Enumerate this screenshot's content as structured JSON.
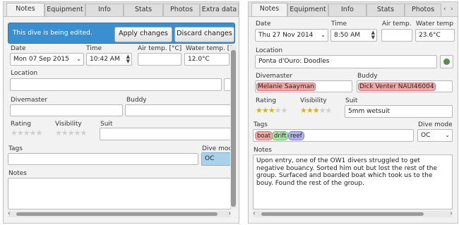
{
  "left": {
    "tabs": [
      "Notes",
      "Equipment",
      "Info",
      "Stats",
      "Photos",
      "Extra data"
    ],
    "banner": {
      "message": "This dive is being edited.",
      "apply": "Apply changes",
      "discard": "Discard changes"
    },
    "labels": {
      "date": "Date",
      "time": "Time",
      "air_temp": "Air temp. [°C]",
      "water_temp": "Water temp. [°C]",
      "location": "Location",
      "divemaster": "Divemaster",
      "buddy": "Buddy",
      "rating": "Rating",
      "visibility": "Visibility",
      "suit": "Suit",
      "tags": "Tags",
      "dive_mode": "Dive mode",
      "notes": "Notes"
    },
    "values": {
      "date": "Mon 07 Sep 2015",
      "time": "10:42 AM",
      "air_temp": "",
      "water_temp": "12.0°C",
      "dive_mode": "OC"
    },
    "rating": 0,
    "visibility": 0
  },
  "right": {
    "tabs": [
      "Notes",
      "Equipment",
      "Info",
      "Stats",
      "Photos"
    ],
    "labels": {
      "date": "Date",
      "time": "Time",
      "air_temp": "Air temp.",
      "water_temp": "Water temp",
      "location": "Location",
      "divemaster": "Divemaster",
      "buddy": "Buddy",
      "rating": "Rating",
      "visibility": "Visibility",
      "suit": "Suit",
      "tags": "Tags",
      "dive_mode": "Dive mode",
      "notes": "Notes"
    },
    "values": {
      "date": "Thu 27 Nov 2014",
      "time": "8:50 AM",
      "air_temp": "",
      "water_temp": "23.6°C",
      "location": "Ponta d'Ouro: Doodles",
      "divemaster": "Melanie Saayman",
      "buddy": "Dick Venter NAUI46004",
      "suit": "5mm wetsuit",
      "dive_mode": "OC",
      "notes": "Upon entry, one of the OW1 divers struggled to get negative bouancy. Sorted him out but lost the rest of the group. Surfaced and boarded boat which took us to the bouy. Found the rest of the group."
    },
    "tags": [
      {
        "label": "boat",
        "color": "#f3a7a7"
      },
      {
        "label": "drift",
        "color": "#a8e6a0"
      },
      {
        "label": "reef",
        "color": "#b3b3f0"
      }
    ],
    "rating": 3,
    "visibility": 3
  },
  "colors": {
    "banner": "#3a8fd0",
    "highlight_red": "#f3a7a7",
    "selected_mode": "#a9d1ee"
  }
}
